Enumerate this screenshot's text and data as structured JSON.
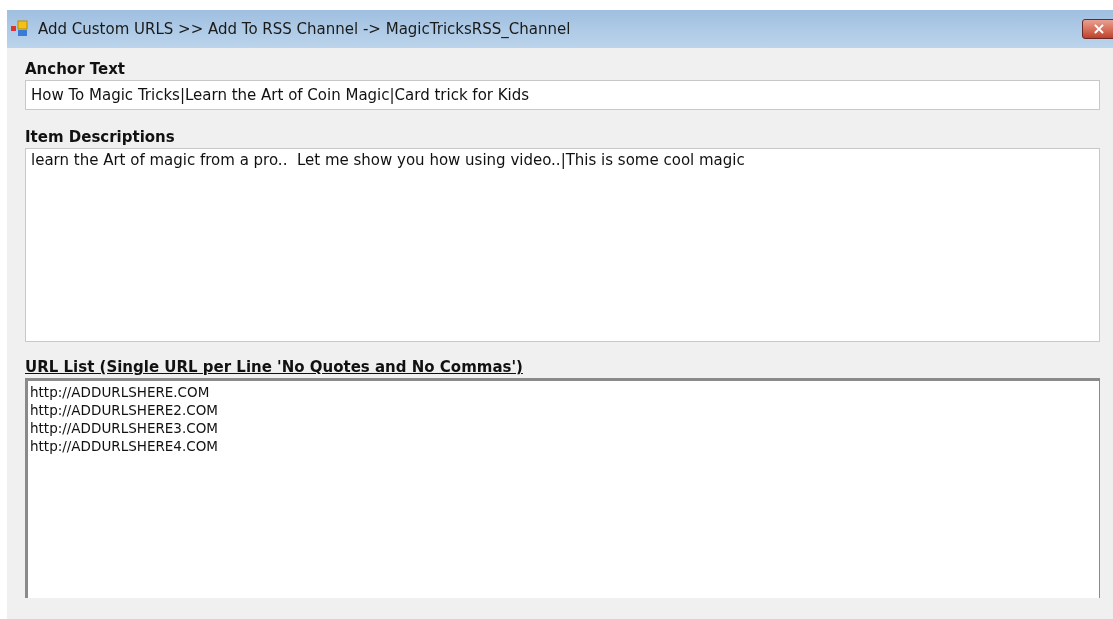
{
  "window": {
    "title": "Add Custom URLS >> Add To RSS Channel -> MagicTricksRSS_Channel",
    "close": "×"
  },
  "anchor_text": {
    "label": "Anchor Text",
    "value": "How To Magic Tricks|Learn the Art of Coin Magic|Card trick for Kids"
  },
  "item_descriptions": {
    "label": "Item Descriptions",
    "value": "learn the Art of magic from a pro..  Let me show you how using video..|This is some cool magic"
  },
  "url_list": {
    "label": "URL List (Single URL per Line 'No Quotes and No Commas')",
    "lines": [
      "http://ADDURLSHERE.COM",
      "http://ADDURLSHERE2.COM",
      "http://ADDURLSHERE3.COM",
      "http://ADDURLSHERE4.COM"
    ]
  }
}
